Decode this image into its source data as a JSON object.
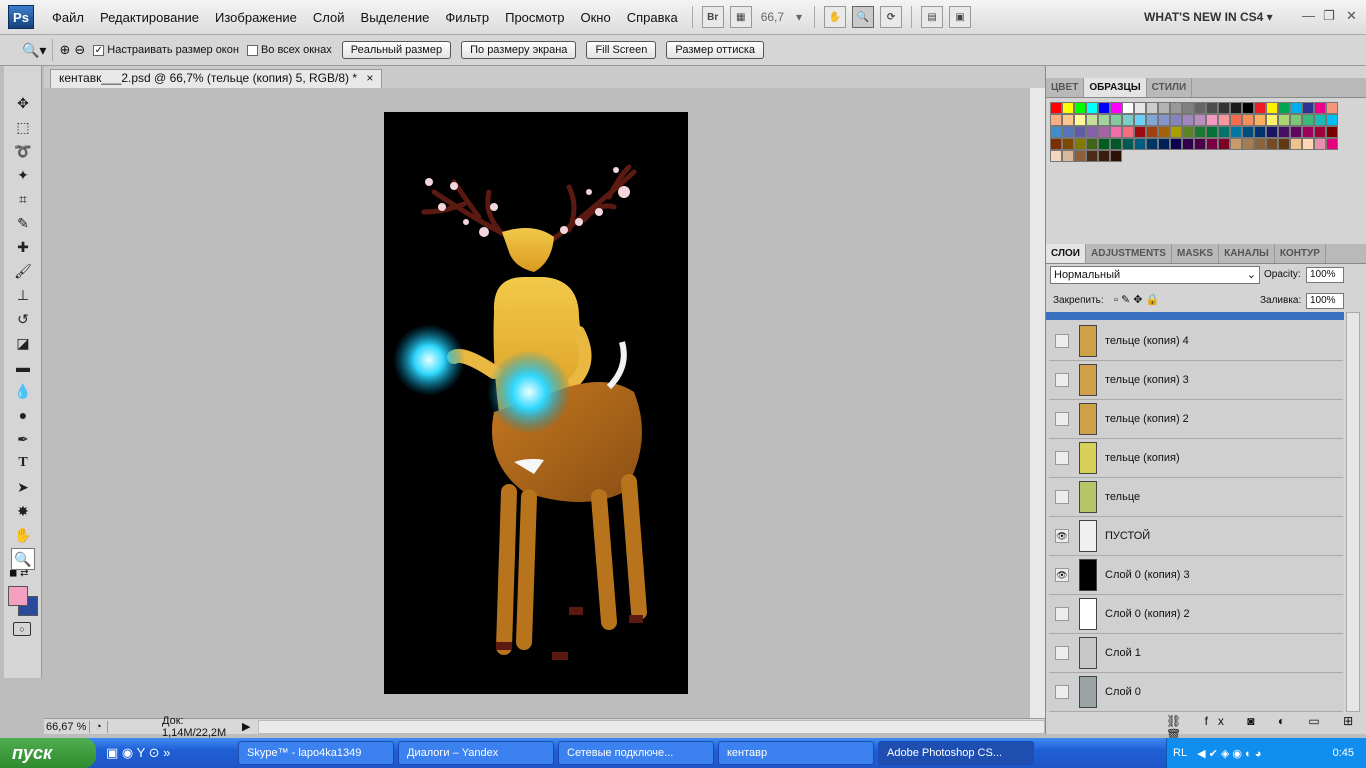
{
  "app": {
    "logo": "Ps"
  },
  "menu": [
    "Файл",
    "Редактирование",
    "Изображение",
    "Слой",
    "Выделение",
    "Фильтр",
    "Просмотр",
    "Окно",
    "Справка"
  ],
  "topbar": {
    "bridge": "Br",
    "zoom": "66,7",
    "whats_new": "WHAT'S NEW IN CS4"
  },
  "options": {
    "resize_windows": "Настраивать размер окон",
    "all_windows": "Во всех окнах",
    "buttons": [
      "Реальный размер",
      "По размеру экрана",
      "Fill Screen",
      "Размер оттиска"
    ]
  },
  "document": {
    "tab_title": "кентавк___2.psd @ 66,7% (тельце (копия) 5, RGB/8) *"
  },
  "status": {
    "zoom": "66,67 %",
    "doc": "Док: 1,14M/22,2M"
  },
  "swatches_panel": {
    "tabs": [
      "ЦВЕТ",
      "ОБРАЗЦЫ",
      "СТИЛИ"
    ]
  },
  "layers_panel": {
    "tabs": [
      "СЛОИ",
      "ADJUSTMENTS",
      "MASKS",
      "КАНАЛЫ",
      "КОНТУР"
    ],
    "blend_mode": "Нормальный",
    "opacity_label": "Opacity:",
    "opacity": "100%",
    "lock_label": "Закрепить:",
    "fill_label": "Заливка:",
    "fill": "100%",
    "layers": [
      {
        "name": "тельце (копия) 4"
      },
      {
        "name": "тельце (копия) 3"
      },
      {
        "name": "тельце (копия) 2"
      },
      {
        "name": "тельце (копия)"
      },
      {
        "name": "тельце"
      },
      {
        "name": "ПУСТОЙ"
      },
      {
        "name": "Слой 0 (копия) 3"
      },
      {
        "name": "Слой 0 (копия) 2"
      },
      {
        "name": "Слой 1"
      },
      {
        "name": "Слой 0"
      }
    ]
  },
  "taskbar": {
    "start": "пуск",
    "tasks": [
      "Skype™ - lapo4ka1349",
      "Диалоги – Yandex",
      "Сетевые подключе...",
      "кентавр",
      "Adobe Photoshop CS..."
    ],
    "lang": "RL",
    "clock": "0:45"
  }
}
